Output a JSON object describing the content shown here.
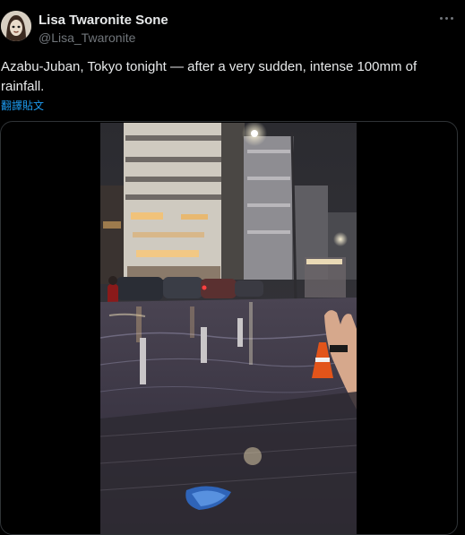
{
  "post": {
    "author_name": "Lisa Twaronite Sone",
    "author_handle": "@Lisa_Twaronite",
    "text": "Azabu-Juban, Tokyo tonight — after a very sudden, intense 100mm of rainfall.",
    "translate_label": "翻譯貼文"
  },
  "icons": {
    "more": "more-dots-icon",
    "avatar": "avatar-illustration"
  },
  "colors": {
    "background": "#000000",
    "text": "#e7e9ea",
    "secondary": "#71767b",
    "link": "#1d9bf0",
    "border": "#2f3336"
  }
}
